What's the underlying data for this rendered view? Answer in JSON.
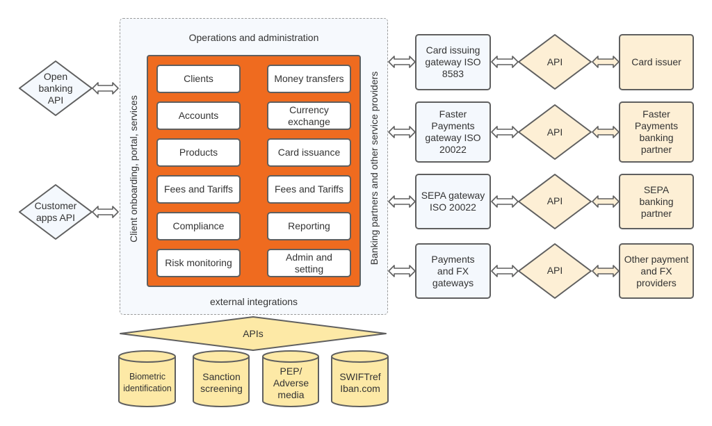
{
  "left_apis": [
    {
      "label": "Open banking API",
      "lines": [
        "Open",
        "banking",
        "API"
      ]
    },
    {
      "label": "Customer apps API",
      "lines": [
        "Customer",
        "apps API"
      ]
    }
  ],
  "platform": {
    "top_label": "Operations and administration",
    "bottom_label": "external integrations",
    "left_label": "Client onboarding, portal, services",
    "right_label": "Banking partners and other service providers",
    "modules_left": [
      "Clients",
      "Accounts",
      "Products",
      "Fees and Tariffs",
      "Compliance",
      "Risk monitoring"
    ],
    "modules_right": [
      "Money transfers",
      "Currency exchange",
      "Card issuance",
      "Fees and Tariffs",
      "Reporting",
      "Admin and setting"
    ]
  },
  "integrations": [
    {
      "gateway": "Card issuing gateway ISO 8583",
      "connector": "API",
      "partner": "Card issuer"
    },
    {
      "gateway": "Faster Payments gateway ISO 20022",
      "connector": "API",
      "partner": "Faster Payments banking partner"
    },
    {
      "gateway": "SEPA gateway ISO 20022",
      "connector": "API",
      "partner": "SEPA banking partner"
    },
    {
      "gateway": "Payments and FX gateways",
      "connector": "API",
      "partner": "Other payment and FX providers"
    }
  ],
  "external_apis": {
    "label": "APIs",
    "services": [
      "Biometric identification",
      "Sanction screening",
      "PEP/ Adverse media",
      "SWIFTref Iban.com"
    ]
  },
  "colors": {
    "core": "#ef6b1f",
    "container_bg": "#f6f9fd",
    "gateway_bg": "#f4f8fd",
    "partner_bg": "#fdefd5",
    "external_bg": "#fde9a6",
    "stroke": "#5f5f5f"
  }
}
